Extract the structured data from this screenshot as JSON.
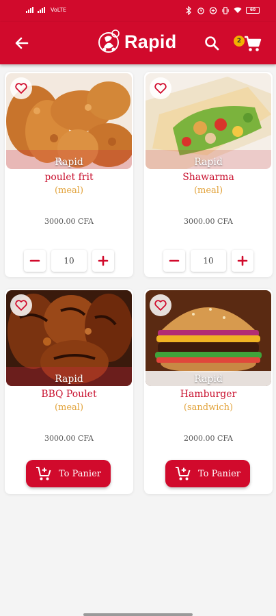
{
  "status_bar": {
    "network": "VoLTE",
    "battery": "60",
    "icons": [
      "bluetooth-icon",
      "alarm-icon",
      "data-saver-icon",
      "vibrate-icon",
      "wifi-icon",
      "battery-icon"
    ]
  },
  "app_bar": {
    "brand": "Rapid",
    "cart_count": "2",
    "icons": [
      "back-arrow-icon",
      "search-icon",
      "cart-icon"
    ]
  },
  "colors": {
    "primary": "#d10a2c",
    "title": "#c8102e",
    "category": "#e2a33b",
    "badge": "#f2b100"
  },
  "products": [
    {
      "image_label": "Rapid",
      "name": "poulet frit",
      "category": "(meal)",
      "price": "3000.00 CFA",
      "quantity": "10"
    },
    {
      "image_label": "Rapid",
      "name": "Shawarma",
      "category": "(meal)",
      "price": "3000.00 CFA",
      "quantity": "10"
    },
    {
      "image_label": "Rapid",
      "name": "BBQ Poulet",
      "category": "(meal)",
      "price": "3000.00 CFA",
      "button_label": "To Panier"
    },
    {
      "image_label": "Rapid",
      "name": "Hamburger",
      "category": "(sandwich)",
      "price": "2000.00 CFA",
      "button_label": "To Panier"
    }
  ]
}
